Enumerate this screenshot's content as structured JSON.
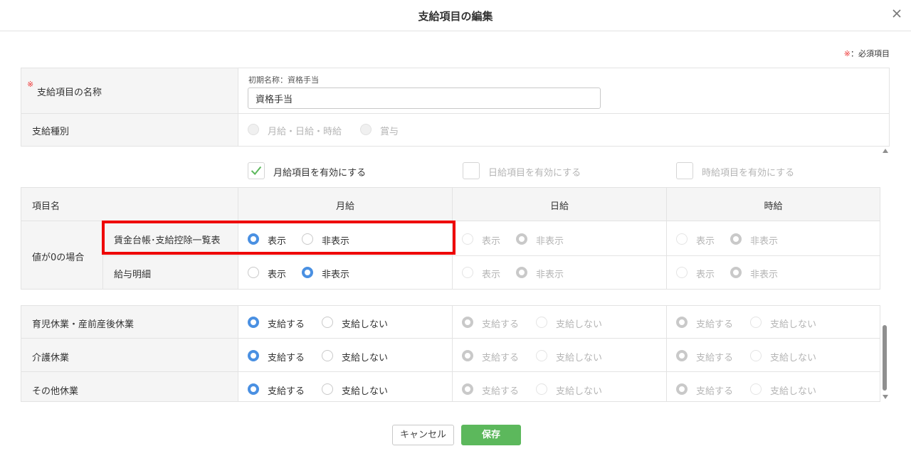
{
  "dialog": {
    "title": "支給項目の編集",
    "required_mark": "※",
    "required_note": "：必須項目"
  },
  "item_name": {
    "required_mark": "※",
    "label": "支給項目の名称",
    "initial_name_label": "初期名称：資格手当",
    "value": "資格手当"
  },
  "pay_type": {
    "label": "支給種別",
    "options": [
      "月給・日給・時給",
      "賞与"
    ],
    "selected": "月給・日給・時給"
  },
  "enable_checks": [
    {
      "label": "月給項目を有効にする",
      "checked": true
    },
    {
      "label": "日給項目を有効にする",
      "checked": false
    },
    {
      "label": "時給項目を有効にする",
      "checked": false
    }
  ],
  "columns": {
    "item_name": "項目名",
    "monthly": "月給",
    "daily": "日給",
    "hourly": "時給"
  },
  "zero_value": {
    "group_label": "値が0の場合",
    "rows": [
      {
        "label": "賃金台帳･支給控除一覧表",
        "monthly": "表示",
        "daily": "非表示",
        "hourly": "非表示"
      },
      {
        "label": "給与明細",
        "monthly": "非表示",
        "daily": "非表示",
        "hourly": "非表示"
      }
    ],
    "show_label": "表示",
    "hide_label": "非表示"
  },
  "leave": {
    "pay_label": "支給する",
    "nopay_label": "支給しない",
    "rows": [
      {
        "label": "育児休業・産前産後休業",
        "monthly": "支給する",
        "daily": "支給する",
        "hourly": "支給する"
      },
      {
        "label": "介護休業",
        "monthly": "支給する",
        "daily": "支給する",
        "hourly": "支給する"
      },
      {
        "label": "その他休業",
        "monthly": "支給する",
        "daily": "支給する",
        "hourly": "支給する"
      }
    ]
  },
  "footer": {
    "cancel": "キャンセル",
    "save": "保存"
  },
  "colors": {
    "accent": "#4a90e2",
    "save": "#5cb85c",
    "highlight": "#ee0000",
    "required": "#e33333"
  }
}
